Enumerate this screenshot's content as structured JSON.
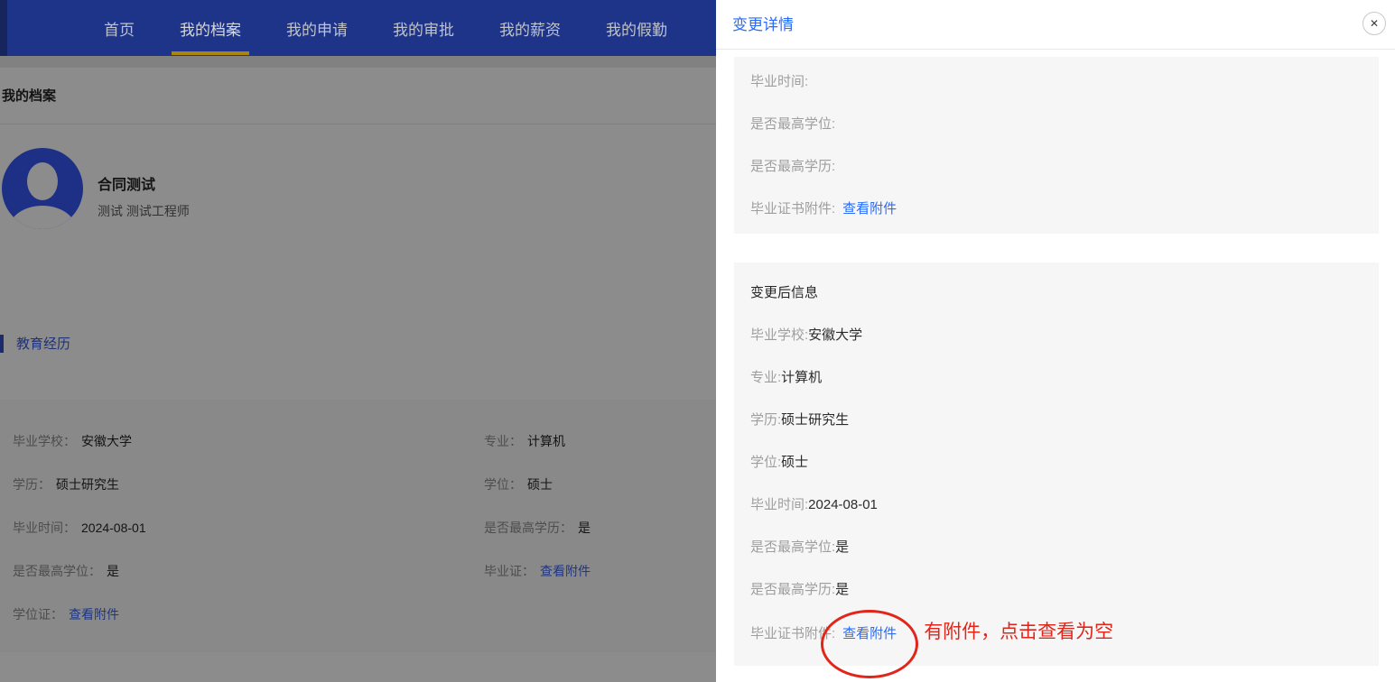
{
  "nav": {
    "items": [
      {
        "label": "首页",
        "active": false
      },
      {
        "label": "我的档案",
        "active": true
      },
      {
        "label": "我的申请",
        "active": false
      },
      {
        "label": "我的审批",
        "active": false
      },
      {
        "label": "我的薪资",
        "active": false
      },
      {
        "label": "我的假勤",
        "active": false
      }
    ]
  },
  "page": {
    "title": "我的档案",
    "profile": {
      "name": "合同测试",
      "subtitle": "测试 测试工程师",
      "avatar_icon": "user-icon"
    },
    "section_title": "教育经历",
    "fields": {
      "col1": [
        {
          "label": "毕业学校：",
          "value": "安徽大学"
        },
        {
          "label": "学历：",
          "value": "硕士研究生"
        },
        {
          "label": "毕业时间：",
          "value": "2024-08-01"
        },
        {
          "label": "是否最高学位：",
          "value": "是"
        },
        {
          "label": "学位证：",
          "link_label": "查看附件"
        }
      ],
      "col2": [
        {
          "label": "专业：",
          "value": "计算机"
        },
        {
          "label": "学位：",
          "value": "硕士"
        },
        {
          "label": "是否最高学历：",
          "value": "是"
        },
        {
          "label": "毕业证：",
          "link_label": "查看附件"
        }
      ]
    }
  },
  "drawer": {
    "title": "变更详情",
    "close_icon": "✕",
    "before_block": {
      "rows": [
        {
          "label": "毕业时间:"
        },
        {
          "label": "是否最高学位:"
        },
        {
          "label": "是否最高学历:"
        },
        {
          "label": "毕业证书附件:",
          "link_label": "查看附件"
        }
      ]
    },
    "after_block": {
      "heading": "变更后信息",
      "rows": [
        {
          "label": "毕业学校:",
          "value": "安徽大学"
        },
        {
          "label": "专业:",
          "value": "计算机"
        },
        {
          "label": "学历:",
          "value": "硕士研究生"
        },
        {
          "label": "学位:",
          "value": "硕士"
        },
        {
          "label": "毕业时间:",
          "value": "2024-08-01"
        },
        {
          "label": "是否最高学位:",
          "value": "是"
        },
        {
          "label": "是否最高学历:",
          "value": "是"
        },
        {
          "label": "毕业证书附件:",
          "link_label": "查看附件"
        }
      ],
      "annotation": "有附件，点击查看为空"
    }
  },
  "colors": {
    "nav_background": "#1e3488",
    "active_tab_underline": "#ab840a",
    "primary_blue": "#2b6bf5",
    "left_link_blue": "#3a62f0",
    "avatar_blue": "#3558f5",
    "annotation_red": "#e1251b",
    "block_background": "#f6f6f6",
    "mask": "rgba(0,0,0,0.45)"
  }
}
